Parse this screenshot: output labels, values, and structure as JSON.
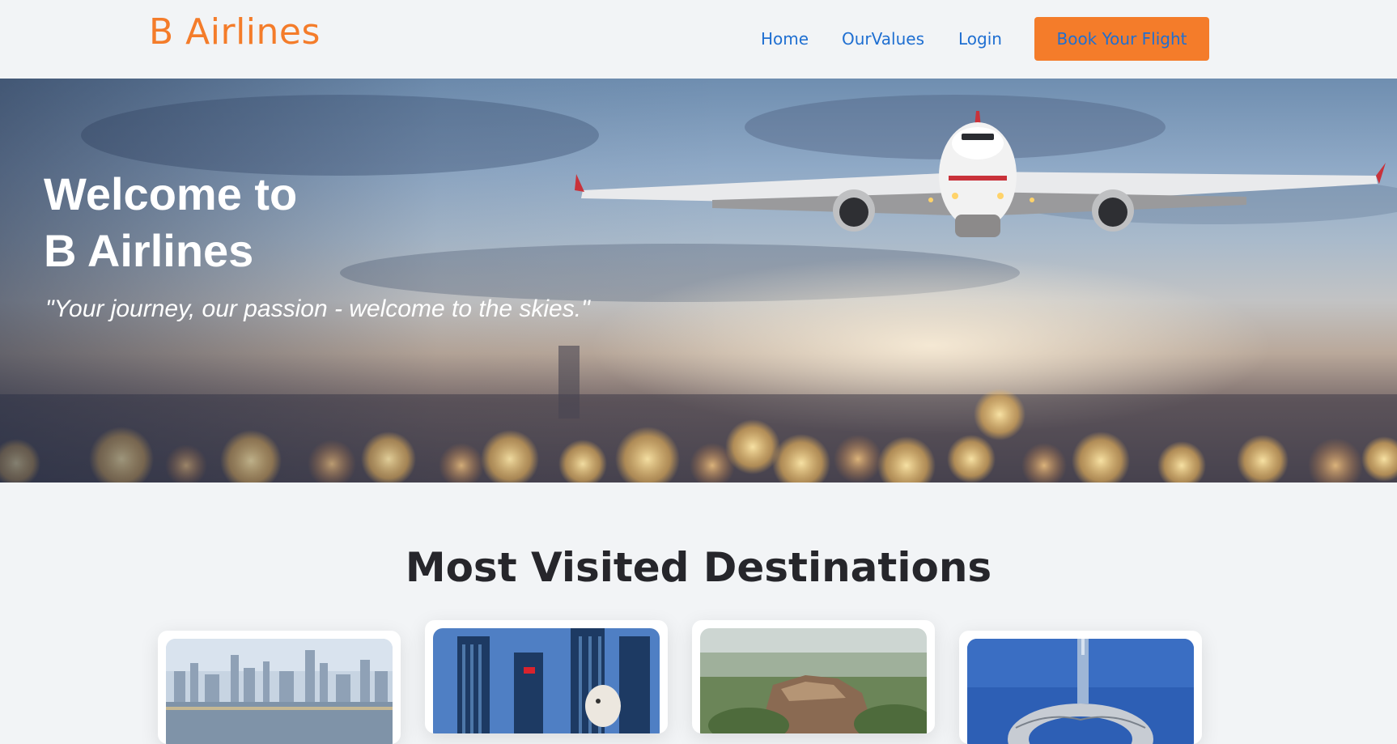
{
  "header": {
    "brand": "B Airlines",
    "nav": {
      "home": "Home",
      "values": "OurValues",
      "login": "Login"
    },
    "book_button": "Book Your Flight"
  },
  "hero": {
    "title_line1": "Welcome to",
    "title_line2": "B Airlines",
    "tagline": "\"Your journey, our passion - welcome to the skies.\""
  },
  "destinations": {
    "heading": "Most Visited Destinations",
    "cards": [
      {
        "image": "city-skyline-river"
      },
      {
        "image": "singapore-merlion-skyline"
      },
      {
        "image": "sigiriya-rock-fortress"
      },
      {
        "image": "dubai-museum-of-the-future"
      }
    ]
  },
  "colors": {
    "brand_orange": "#f47c2a",
    "link_blue": "#1f6fd1",
    "page_bg": "#f2f4f6",
    "heading_dark": "#26262b"
  }
}
